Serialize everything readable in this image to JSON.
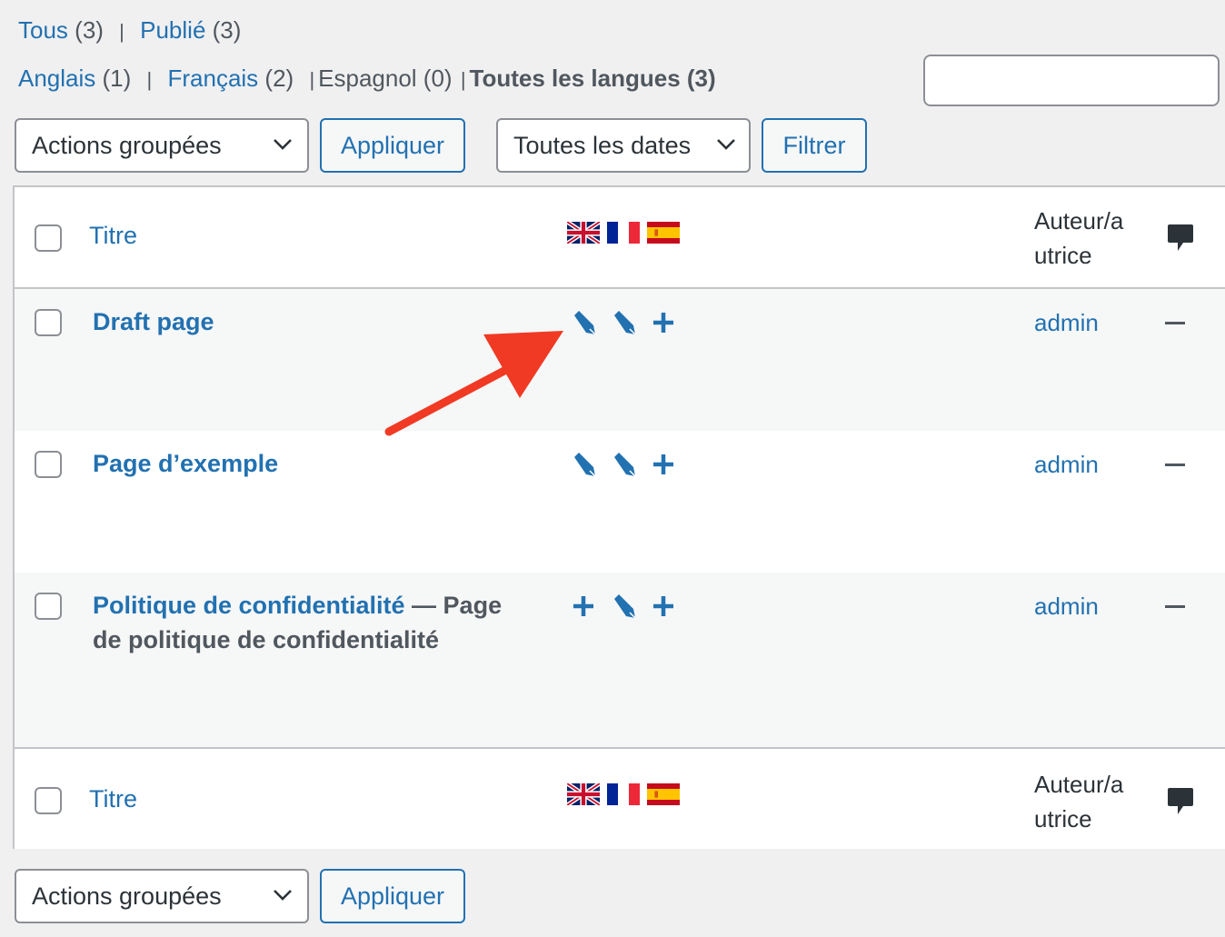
{
  "status_filter": {
    "items": [
      {
        "label": "Tous",
        "count": "(3)"
      },
      {
        "label": "Publié",
        "count": "(3)"
      }
    ]
  },
  "lang_filter": {
    "items": [
      {
        "label": "Anglais",
        "count": "(1)"
      },
      {
        "label": "Français",
        "count": "(2)"
      },
      {
        "label": "Espagnol (0)"
      },
      {
        "label": "Toutes les langues (3)"
      }
    ]
  },
  "search": {
    "placeholder": ""
  },
  "toolbar_top": {
    "bulk_actions": "Actions groupées",
    "apply": "Appliquer",
    "dates": "Toutes les dates",
    "filter": "Filtrer"
  },
  "table": {
    "col_title": "Titre",
    "col_author_1": "Auteur/a",
    "col_author_2": "utrice",
    "flags": [
      "uk-flag",
      "france-flag",
      "spain-flag"
    ],
    "rows": [
      {
        "title": "Draft page",
        "state": "",
        "author": "admin",
        "comments": "—",
        "icons": [
          "edit-pencil-icon",
          "edit-pencil-icon",
          "add-translation-icon"
        ]
      },
      {
        "title": "Page d’exemple",
        "state": "",
        "author": "admin",
        "comments": "—",
        "icons": [
          "edit-pencil-icon",
          "edit-pencil-icon",
          "add-translation-icon"
        ]
      },
      {
        "title": "Politique de confidentialité",
        "state": "— Page de politique de confidentialité",
        "author": "admin",
        "comments": "—",
        "icons": [
          "add-translation-icon",
          "edit-pencil-icon",
          "add-translation-icon"
        ]
      }
    ]
  },
  "toolbar_bottom": {
    "bulk_actions": "Actions groupées",
    "apply": "Appliquer"
  },
  "colors": {
    "link": "#2271b1",
    "arrow": "#f03a24",
    "background": "#f0f0f1"
  }
}
